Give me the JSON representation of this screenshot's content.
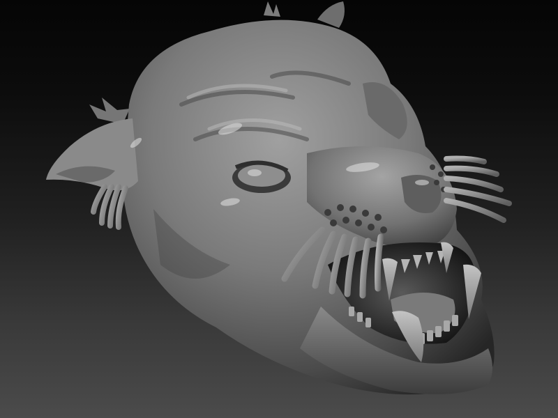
{
  "scene": {
    "subject": "sculpted-panther-head",
    "material": "matte-grey-clay",
    "colors": {
      "background_top": "#050505",
      "background_bottom": "#4b4b4b",
      "clay_light": "#9a9a9a",
      "clay_mid": "#6c6c6c",
      "clay_dark": "#2a2a2a",
      "mouth_dark": "#141414"
    }
  }
}
